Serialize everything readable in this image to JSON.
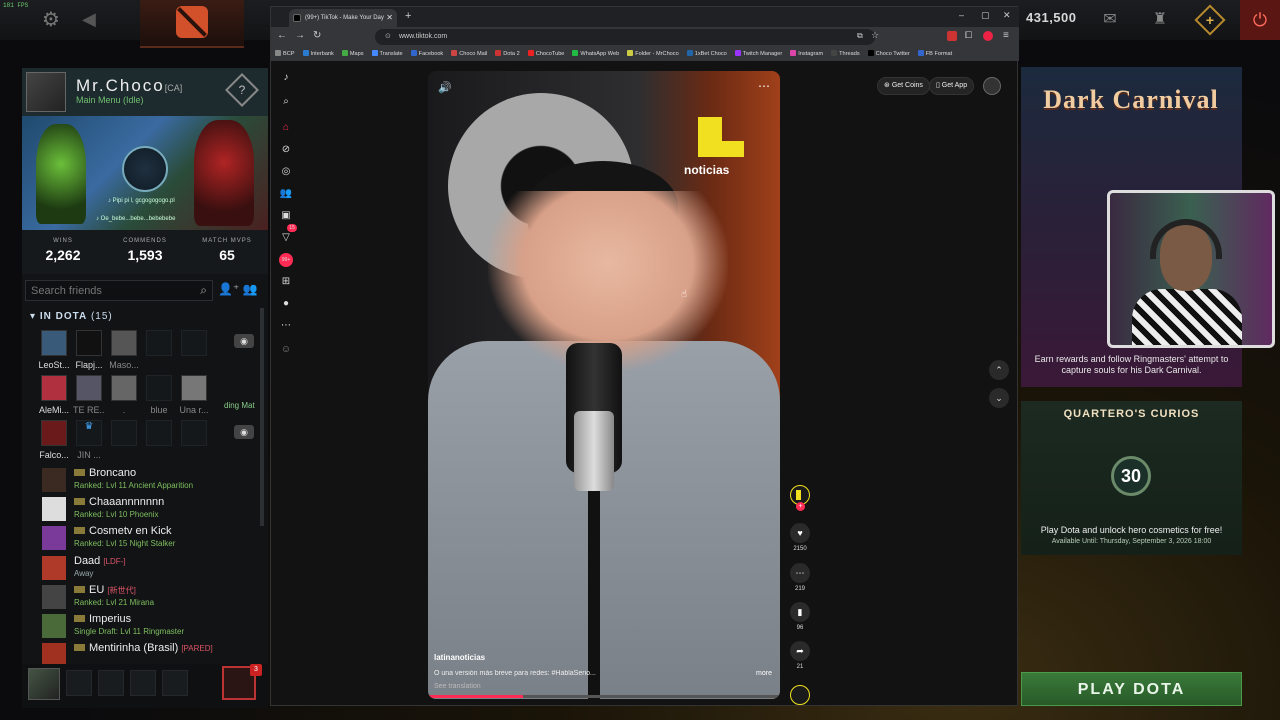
{
  "dota": {
    "fps": "181 FPS",
    "shards": "431,500",
    "profile": {
      "name": "Mr.Choco",
      "tag": "[CA]",
      "status": "Main Menu (Idle)",
      "music_line1": "Pipi pi l, gcgogogogo.pl",
      "music_line2": "Oe_bebe...bebe...bebebebe"
    },
    "stats": [
      {
        "label": "WINS",
        "value": "2,262"
      },
      {
        "label": "COMMENDS",
        "value": "1,593"
      },
      {
        "label": "MATCH MVPS",
        "value": "65"
      }
    ],
    "friends_search_placeholder": "Search friends",
    "in_dota_label": "IN DOTA",
    "in_dota_count": "(15)",
    "grid_row1": [
      "LeoSt...",
      "Flapj...",
      "Maso...",
      "",
      "",
      ""
    ],
    "grid_row2": [
      "AleMi...",
      "TE RE...",
      ".",
      "blue",
      "Una r..."
    ],
    "grid_row3": [
      "Falco...",
      "JIN ...",
      "",
      "",
      ""
    ],
    "ding_text": "ding Mat",
    "friends": [
      {
        "name": "Broncano",
        "tag": "",
        "status": "Ranked: Lvl 11 Ancient Apparition"
      },
      {
        "name": "Chaaannnnnnn",
        "tag": "",
        "status": "Ranked: Lvl 10 Phoenix"
      },
      {
        "name": "Cosmetv en Kick",
        "tag": "",
        "status": "Ranked: Lvl 15 Night Stalker"
      },
      {
        "name": "Daad",
        "tag": "[LDF-]",
        "status": "Away"
      },
      {
        "name": "EU",
        "tag": "[新世代]",
        "status": "Ranked: Lvl 21 Mirana"
      },
      {
        "name": "Imperius",
        "tag": "",
        "status": "Single Draft: Lvl 11 Ringmaster"
      },
      {
        "name": "Mentirinha (Brasil)",
        "tag": "[PARED]",
        "status": ""
      }
    ],
    "party_count": "3",
    "carnival": {
      "title": "Dark Carnival",
      "caption": "Earn rewards and follow Ringmasters' attempt to capture souls for his Dark Carnival."
    },
    "curios": {
      "title": "QUARTERO'S CURIOS",
      "badge": "30",
      "desc": "Play Dota and unlock hero cosmetics for free!",
      "avail": "Available Until: Thursday, September 3, 2026 18:00"
    },
    "play_button": "PLAY DOTA"
  },
  "browser": {
    "tab_title": "(99+) TikTok - Make Your Day",
    "url": "www.tiktok.com",
    "bookmarks": [
      "BCP",
      "Interbank",
      "Maps",
      "Translate",
      "Facebook",
      "Choco Mail",
      "Dota 2",
      "ChocoTube",
      "WhatsApp Web",
      "Folder - MrChoco",
      "1xBet Choco",
      "Twitch Manager",
      "Instagram",
      "Threads",
      "Choco Twitter",
      "FB Format"
    ]
  },
  "tiktok": {
    "get_coins": "Get Coins",
    "get_app": "Get App",
    "inbox_badge": "99+",
    "notif_badge": "15",
    "logo_text": "noticias",
    "username": "latinanoticias",
    "caption": "O una versión más breve para redes: #HablaSerio...",
    "more": "more",
    "see_translation": "See translation",
    "progress": 0.27,
    "likes": "2150",
    "comments": "219",
    "saves": "96",
    "shares": "21"
  }
}
